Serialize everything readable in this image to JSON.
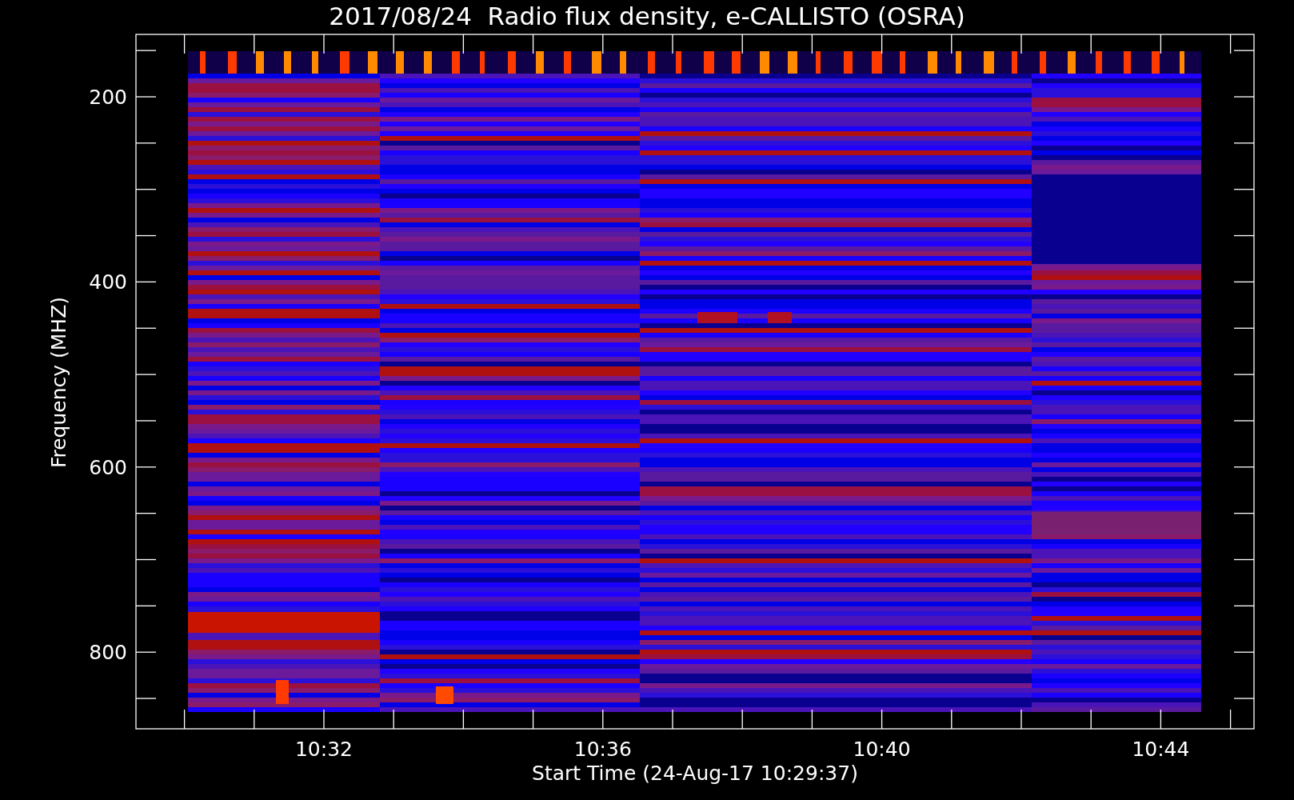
{
  "title": "2017/08/24  Radio flux density, e-CALLISTO (OSRA)",
  "y_axis": {
    "label": "Frequency (MHZ)",
    "tick_labels": [
      "200",
      "400",
      "600",
      "800"
    ]
  },
  "x_axis": {
    "label": "Start Time (24-Aug-17 10:29:37)",
    "tick_labels": [
      "10:32",
      "10:36",
      "10:40",
      "10:44"
    ]
  }
}
